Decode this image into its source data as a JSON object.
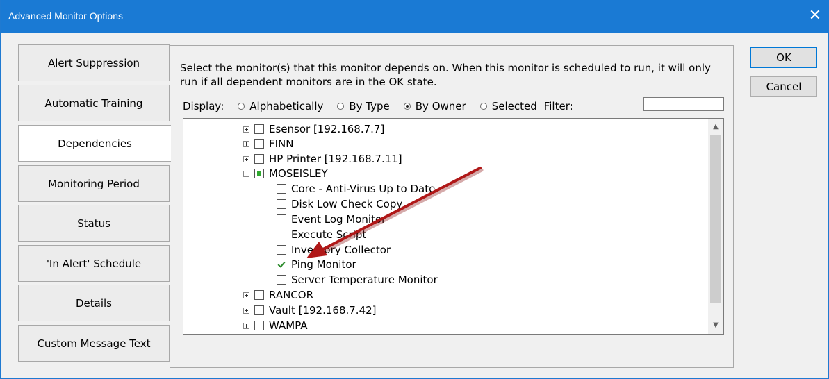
{
  "window": {
    "title": "Advanced Monitor Options",
    "close_glyph": "✕"
  },
  "tabs": [
    {
      "label": "Alert Suppression"
    },
    {
      "label": "Automatic Training"
    },
    {
      "label": "Dependencies",
      "active": true
    },
    {
      "label": "Monitoring Period"
    },
    {
      "label": "Status"
    },
    {
      "label": "'In Alert' Schedule"
    },
    {
      "label": "Details"
    },
    {
      "label": "Custom Message Text"
    }
  ],
  "dependencies": {
    "description": "Select the monitor(s) that this monitor depends on.  When this monitor is scheduled to run, it will only run if all dependent monitors  are in the OK state.",
    "display_label": "Display:",
    "display_options": [
      {
        "label": "Alphabetically",
        "selected": false
      },
      {
        "label": "By Type",
        "selected": false
      },
      {
        "label": "By Owner",
        "selected": true
      },
      {
        "label": "Selected",
        "selected": false
      }
    ],
    "filter_label": "Filter:",
    "filter_value": ""
  },
  "tree": {
    "items": [
      {
        "label": "Esensor [192.168.7.7]",
        "expander": "plus",
        "check": "none"
      },
      {
        "label": "FINN",
        "expander": "plus",
        "check": "none"
      },
      {
        "label": "HP Printer [192.168.7.11]",
        "expander": "plus",
        "check": "none"
      },
      {
        "label": "MOSEISLEY",
        "expander": "minus",
        "check": "partial"
      },
      {
        "label": "Core - Anti-Virus Up to Date",
        "check": "none"
      },
      {
        "label": "Disk Low Check Copy",
        "check": "none"
      },
      {
        "label": "Event Log Monitor",
        "check": "none"
      },
      {
        "label": "Execute Script",
        "check": "none"
      },
      {
        "label": "Inventory Collector",
        "check": "none"
      },
      {
        "label": "Ping Monitor",
        "check": "checked"
      },
      {
        "label": "Server Temperature Monitor",
        "check": "none"
      },
      {
        "label": "RANCOR",
        "expander": "plus",
        "check": "none"
      },
      {
        "label": "Vault [192.168.7.42]",
        "expander": "plus",
        "check": "none"
      },
      {
        "label": "WAMPA",
        "expander": "plus",
        "check": "none"
      }
    ]
  },
  "buttons": {
    "ok": "OK",
    "cancel": "Cancel"
  },
  "colors": {
    "titlebar": "#1a7ad4",
    "annotation_arrow": "#b01818"
  }
}
